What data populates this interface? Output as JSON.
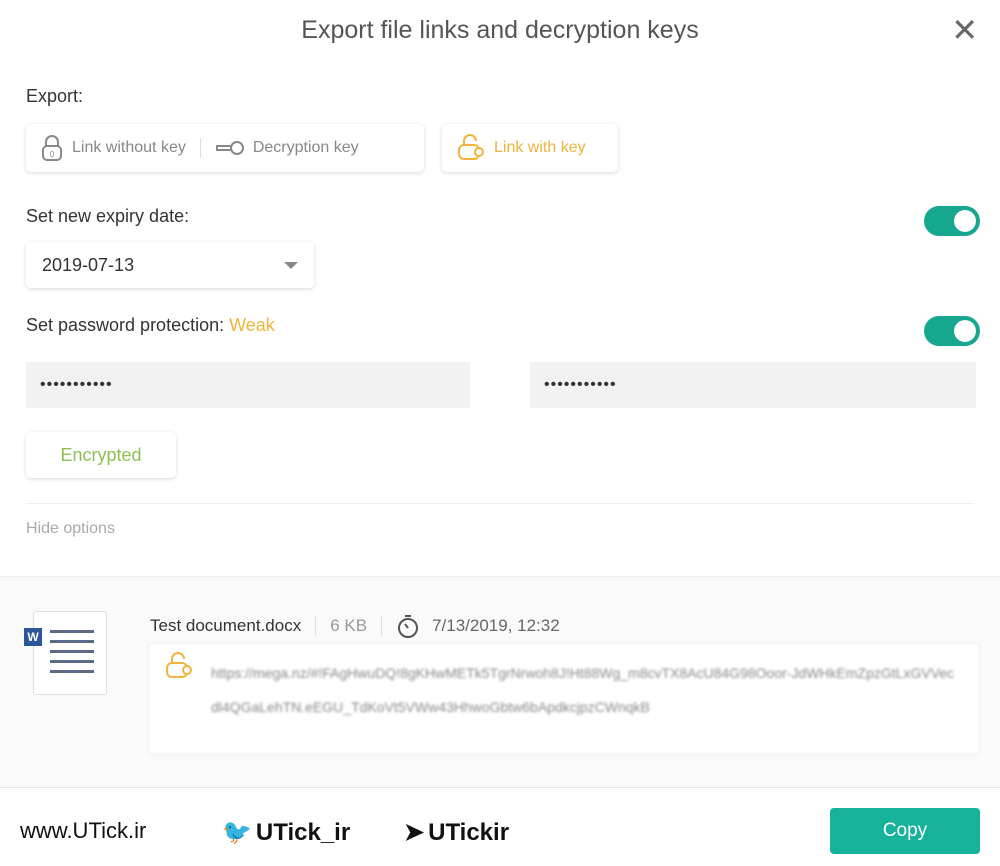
{
  "dialog": {
    "title": "Export file links and decryption keys"
  },
  "export": {
    "label": "Export:",
    "options": [
      {
        "label": "Link without key",
        "icon": "lock-icon"
      },
      {
        "label": "Decryption key",
        "icon": "key-icon"
      },
      {
        "label": "Link with key",
        "icon": "lock-key-icon",
        "selected": true
      }
    ]
  },
  "expiry": {
    "label": "Set new expiry date:",
    "value": "2019-07-13",
    "enabled": true
  },
  "password": {
    "label": "Set password protection:",
    "strength": "Weak",
    "value": "•••••••••••",
    "confirm": "•••••••••••",
    "enabled": true
  },
  "encrypted_label": "Encrypted",
  "hide_options": "Hide options",
  "file": {
    "name": "Test document.docx",
    "size": "6 KB",
    "date": "7/13/2019, 12:32",
    "link": "https://mega.nz/#!FAgHwuDQ!8gKHwMETk5TgrNrwoh8J!Ht88Wg_m8cvTX8AcU84G98Ooor-JdWHkEmZpzGtLxGVVecdl4QGaLehTN.eEGU_TdKoVt5VWw43HhwoGbtw6bApdkcjpzCWnqkB"
  },
  "watermark": {
    "site": "www.UTick.ir",
    "twitter": "UTick_ir",
    "telegram": "UTickir"
  },
  "copy_label": "Copy",
  "colors": {
    "accent": "#16b39a",
    "selected": "#f0b43c",
    "encrypted": "#8cc152"
  }
}
